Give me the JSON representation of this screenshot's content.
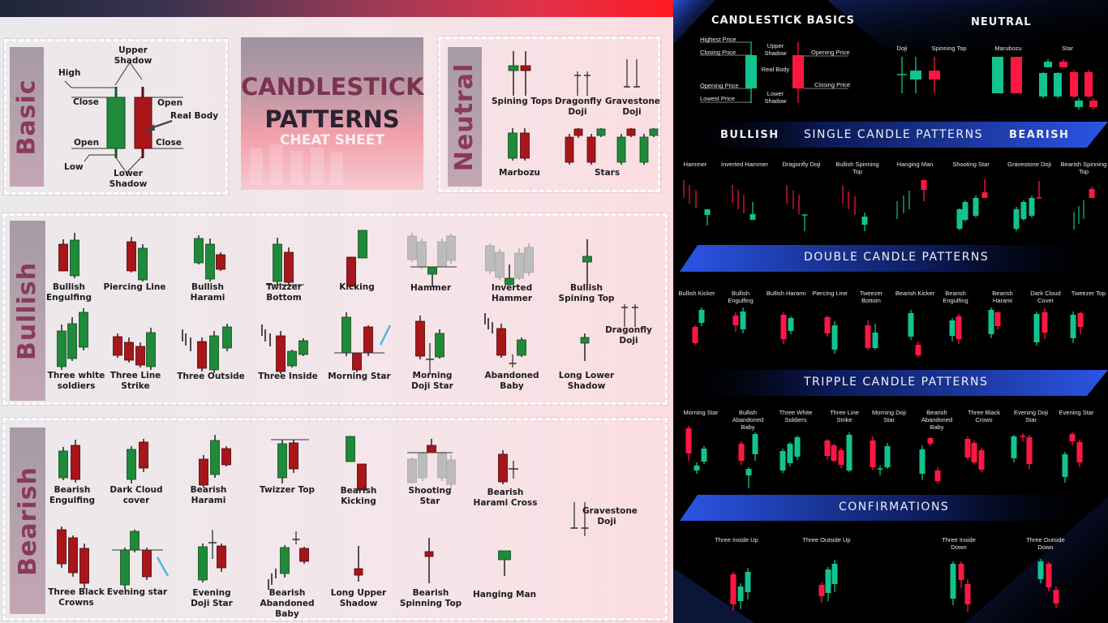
{
  "colors": {
    "bull_left": "#1f8a3a",
    "bear_left": "#a8161a",
    "gray_left": "#bcbcbc",
    "bull_right": "#12c28f",
    "bear_right": "#ff1744",
    "label_accent": "#8a3a5a",
    "banner_blue": "#2a52e0"
  },
  "left": {
    "title": {
      "line1": "CANDLESTICK",
      "line2": "PATTERNS",
      "line3": "CHEAT SHEET"
    },
    "basic": {
      "section_label": "Basic",
      "labels": {
        "high": "High",
        "upper_shadow": "Upper Shadow",
        "close_green": "Close",
        "open_green": "Open",
        "low": "Low",
        "lower_shadow": "Lower Shadow",
        "open_red": "Open",
        "real_body": "Real Body",
        "close_red": "Close"
      }
    },
    "neutral": {
      "section_label": "Neutral",
      "patterns": [
        "Spining Tops",
        "Dragonfly Doji",
        "Gravestone Doji",
        "Marbozu",
        "Stars"
      ]
    },
    "bullish": {
      "section_label": "Bullish",
      "patterns": [
        "Bullish Engulfing",
        "Piercing Line",
        "Bullish Harami",
        "Twizzer Bottom",
        "Kicking",
        "Hammer",
        "Inverted Hammer",
        "Bullish Spining Top",
        "Dragonfly Doji",
        "Three white soldiers",
        "Three Line Strike",
        "Three Outside",
        "Three Inside",
        "Morning Star",
        "Morning Doji Star",
        "Abandoned Baby",
        "Long Lower Shadow"
      ]
    },
    "bearish": {
      "section_label": "Bearish",
      "patterns": [
        "Bearish Engulfing",
        "Dark Cloud cover",
        "Bearish Harami",
        "Twizzer Top",
        "Bearish Kicking",
        "Shooting Star",
        "Bearish Harami Cross",
        "Gravestone Doji",
        "Three Black Crowns",
        "Evening star",
        "Evening Doji Star",
        "Bearish Abandoned Baby",
        "Long Upper Shadow",
        "Bearish Spinning Top",
        "Hanging Man"
      ]
    }
  },
  "right": {
    "basics": {
      "title": "CANDLESTICK BASICS",
      "highest_price": "Highest Price",
      "closing_price": "Closing Price",
      "opening_price": "Opening Price",
      "lowest_price": "Lowest Price",
      "upper_shadow": "Upper Shadow",
      "real_body": "Real Body",
      "lower_shadow": "Lower Shadow",
      "opening_price_r": "Opening Price",
      "closing_price_r": "Closing Price"
    },
    "neutral": {
      "title": "NEUTRAL",
      "patterns": [
        "Doji",
        "Spinning Top",
        "Marubozu",
        "Star"
      ]
    },
    "single": {
      "title": "SINGLE CANDLE PATTERNS",
      "bullish": "BULLISH",
      "bearish": "BEARISH",
      "patterns": [
        "Hammer",
        "Inverted Hammer",
        "Dragonfly Doji",
        "Bullish Spinning Top",
        "Hanging Man",
        "Shooting Star",
        "Gravestone Doji",
        "Bearish Spinning Top"
      ]
    },
    "double": {
      "title": "DOUBLE CANDLE PATTERNS",
      "patterns": [
        "Bullish Kicker",
        "Bullish Engulfing",
        "Bullish Harami",
        "Piercing Line",
        "Tweezer Bottom",
        "Bearish Kicker",
        "Bearish Engulfing",
        "Bearish Harami",
        "Dark Cloud Cover",
        "Tweezer Top"
      ]
    },
    "triple": {
      "title": "TRIPPLE CANDLE PATTERNS",
      "patterns": [
        "Morning Star",
        "Bullish Abandoned Baby",
        "Three White Soldiers",
        "Three Line Strike",
        "Morning Doji Star",
        "Bearish Abandoned Baby",
        "Three Black Crows",
        "Evening Doji Star",
        "Evening Star"
      ]
    },
    "confirmations": {
      "title": "CONFIRMATIONS",
      "patterns": [
        "Three Inside Up",
        "Three Outside Up",
        "Three Inside Down",
        "Three Outside Down"
      ]
    }
  }
}
